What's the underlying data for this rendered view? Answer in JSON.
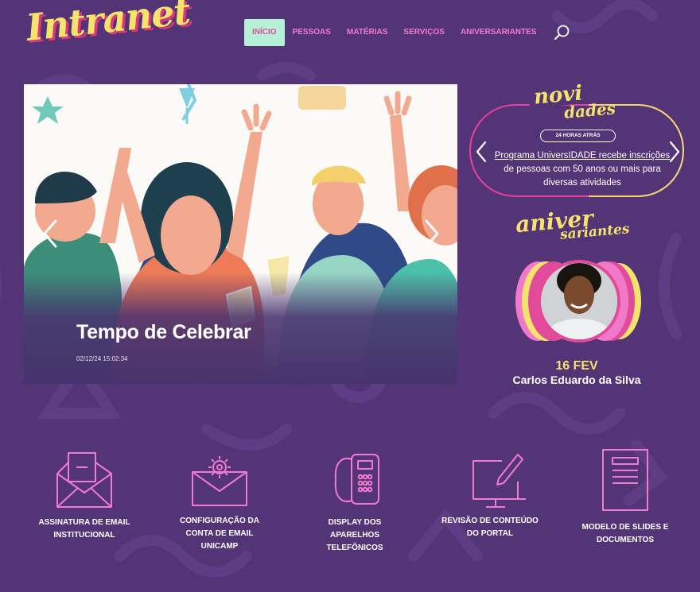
{
  "header": {
    "logo": "Intranet",
    "nav": [
      {
        "label": "INÍCIO",
        "active": true
      },
      {
        "label": "PESSOAS",
        "active": false
      },
      {
        "label": "MATÉRIAS",
        "active": false
      },
      {
        "label": "SERVIÇOS",
        "active": false
      },
      {
        "label": "ANIVERSARIANTES",
        "active": false
      }
    ],
    "search_icon": "search-icon"
  },
  "hero": {
    "title": "Tempo de Celebrar",
    "date": "02/12/24 15:02:34",
    "prev_icon": "chevron-left-icon",
    "next_icon": "chevron-right-icon"
  },
  "news": {
    "heading_line1": "novi",
    "heading_line2": "dades",
    "badge": "24 HORAS ATRÁS",
    "link_text": "Programa UniversIDADE recebe inscrições",
    "rest_text": " de pessoas com 50 anos ou mais para diversas atividades"
  },
  "birthdays": {
    "heading_line1": "aniver",
    "heading_line2": "sariantes",
    "date": "16 FEV",
    "name": "Carlos Eduardo da Silva"
  },
  "services": [
    {
      "label": "ASSINATURA DE EMAIL INSTITUCIONAL",
      "icon": "envelope-open-icon"
    },
    {
      "label": "CONFIGURAÇÃO DA CONTA DE EMAIL UNICAMP",
      "icon": "envelope-gear-icon"
    },
    {
      "label": "DISPLAY DOS APARELHOS TELEFÔNICOS",
      "icon": "desk-phone-icon"
    },
    {
      "label": "REVISÃO DE CONTEÚDO DO PORTAL",
      "icon": "monitor-pen-icon"
    },
    {
      "label": "MODELO DE SLIDES E DOCUMENTOS",
      "icon": "document-icon"
    }
  ],
  "colors": {
    "background": "#533476",
    "accent_pink": "#f37ad0",
    "accent_yellow": "#f5e36c",
    "active_nav_bg": "#b6f0d6"
  }
}
